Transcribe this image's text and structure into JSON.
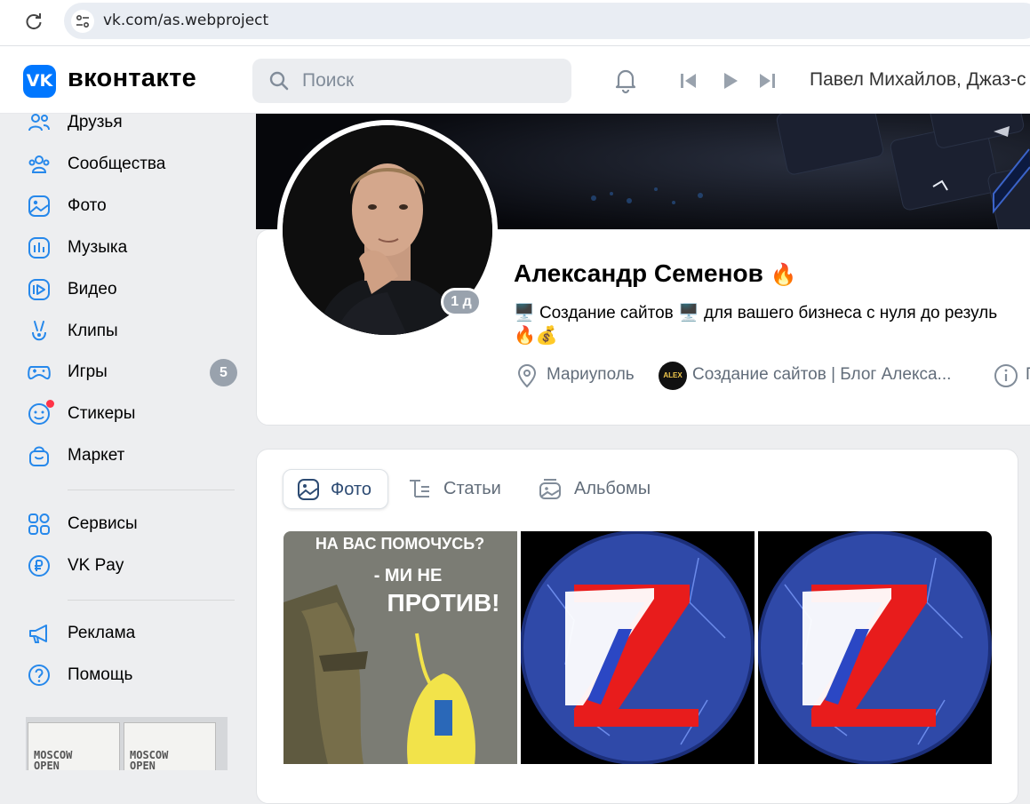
{
  "browser": {
    "url": "vk.com/as.webproject"
  },
  "header": {
    "logo_letters": "VK",
    "logo_word": "вконтакте",
    "search_placeholder": "Поиск",
    "now_playing": "Павел Михайлов, Джаз-с"
  },
  "sidebar": {
    "items": [
      {
        "label": "Друзья",
        "icon": "friends-icon"
      },
      {
        "label": "Сообщества",
        "icon": "communities-icon"
      },
      {
        "label": "Фото",
        "icon": "photo-icon"
      },
      {
        "label": "Музыка",
        "icon": "music-icon"
      },
      {
        "label": "Видео",
        "icon": "video-icon"
      },
      {
        "label": "Клипы",
        "icon": "clips-icon"
      },
      {
        "label": "Игры",
        "icon": "games-icon",
        "badge": "5"
      },
      {
        "label": "Стикеры",
        "icon": "stickers-icon"
      },
      {
        "label": "Маркет",
        "icon": "market-icon"
      },
      {
        "label": "Сервисы",
        "icon": "services-icon"
      },
      {
        "label": "VK Pay",
        "icon": "vkpay-icon"
      },
      {
        "label": "Реклама",
        "icon": "ads-icon"
      },
      {
        "label": "Помощь",
        "icon": "help-icon"
      }
    ],
    "ad_cards": [
      "MOSCOW\nOPEN",
      "MOSCOW\nOPEN"
    ]
  },
  "profile": {
    "name": "Александр Семенов",
    "online": "1 д",
    "status_line1": "Создание сайтов 🖥️ для вашего бизнеса с нуля до резуль",
    "status_line2": "🔥💰",
    "city": "Мариуполь",
    "group_badge_text": "ALEX",
    "group": "Создание сайтов | Блог Алекса...",
    "more_info": "П"
  },
  "content": {
    "tabs": [
      {
        "label": "Фото",
        "active": true
      },
      {
        "label": "Статьи",
        "active": false
      },
      {
        "label": "Альбомы",
        "active": false
      }
    ],
    "poster_text": [
      "НА ВАС ПОМОЧУСЬ?",
      "- МИ НЕ",
      "ПРОТИВ!"
    ]
  },
  "colors": {
    "accent": "#2688eb",
    "vk_blue": "#0077ff",
    "badge_grey": "#99a2ad",
    "notify_red": "#ff3347"
  }
}
